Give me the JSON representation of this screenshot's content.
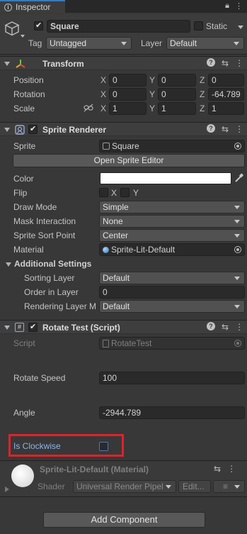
{
  "tab": {
    "label": "Inspector",
    "lock_icon": "lock-icon",
    "menu_icon": "kebab-menu-icon"
  },
  "gameobject": {
    "name": "Square",
    "static_label": "Static",
    "tag_label": "Tag",
    "tag_value": "Untagged",
    "layer_label": "Layer",
    "layer_value": "Default"
  },
  "transform": {
    "title": "Transform",
    "position_label": "Position",
    "rotation_label": "Rotation",
    "scale_label": "Scale",
    "axes": {
      "x": "X",
      "y": "Y",
      "z": "Z"
    },
    "position": {
      "x": "0",
      "y": "0",
      "z": "0"
    },
    "rotation": {
      "x": "0",
      "y": "0",
      "z": "-64.789"
    },
    "scale": {
      "x": "1",
      "y": "1",
      "z": "1"
    }
  },
  "sprite_renderer": {
    "title": "Sprite Renderer",
    "sprite_label": "Sprite",
    "sprite_value": "Square",
    "open_editor_label": "Open Sprite Editor",
    "color_label": "Color",
    "color_value": "#ffffff",
    "flip_label": "Flip",
    "flip_x": "X",
    "flip_y": "Y",
    "draw_mode_label": "Draw Mode",
    "draw_mode_value": "Simple",
    "mask_label": "Mask Interaction",
    "mask_value": "None",
    "sort_point_label": "Sprite Sort Point",
    "sort_point_value": "Center",
    "material_label": "Material",
    "material_value": "Sprite-Lit-Default",
    "additional_label": "Additional Settings",
    "sorting_layer_label": "Sorting Layer",
    "sorting_layer_value": "Default",
    "order_label": "Order in Layer",
    "order_value": "0",
    "rendering_layer_label": "Rendering Layer M",
    "rendering_layer_value": "Default"
  },
  "rotate_script": {
    "title": "Rotate Test (Script)",
    "script_label": "Script",
    "script_value": "RotateTest",
    "speed_label": "Rotate Speed",
    "speed_value": "100",
    "angle_label": "Angle",
    "angle_value": "-2944.789",
    "clockwise_label": "Is Clockwise"
  },
  "material": {
    "title": "Sprite-Lit-Default (Material)",
    "shader_label": "Shader",
    "shader_value": "Universal Render Pipel",
    "edit_label": "Edit..."
  },
  "add_component_label": "Add Component",
  "colors": {
    "highlight": "#e0212b",
    "accent": "#3a79bb"
  }
}
